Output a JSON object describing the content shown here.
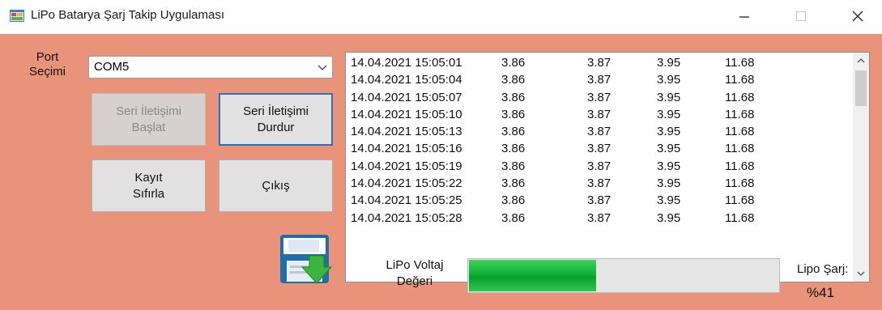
{
  "window": {
    "title": "LiPo Batarya Şarj Takip Uygulaması",
    "icon": "app-form-icon",
    "controls": [
      "minimize-icon",
      "maximize-icon",
      "close-icon"
    ],
    "background_color": "#E8937A"
  },
  "port": {
    "label_line1": "Port",
    "label_line2": "Seçimi",
    "selected": "COM5"
  },
  "buttons": {
    "start_line1": "Seri İletişimi",
    "start_line2": "Başlat",
    "stop_line1": "Seri İletişimi",
    "stop_line2": "Durdur",
    "reset_line1": "Kayıt",
    "reset_line2": "Sıfırla",
    "exit": "Çıkış"
  },
  "log": {
    "rows": [
      [
        "14.04.2021 15:05:01",
        "3.86",
        "3.87",
        "3.95",
        "11.68"
      ],
      [
        "14.04.2021 15:05:04",
        "3.86",
        "3.87",
        "3.95",
        "11.68"
      ],
      [
        "14.04.2021 15:05:07",
        "3.86",
        "3.87",
        "3.95",
        "11.68"
      ],
      [
        "14.04.2021 15:05:10",
        "3.86",
        "3.87",
        "3.95",
        "11.68"
      ],
      [
        "14.04.2021 15:05:13",
        "3.86",
        "3.87",
        "3.95",
        "11.68"
      ],
      [
        "14.04.2021 15:05:16",
        "3.86",
        "3.87",
        "3.95",
        "11.68"
      ],
      [
        "14.04.2021 15:05:19",
        "3.86",
        "3.87",
        "3.95",
        "11.68"
      ],
      [
        "14.04.2021 15:05:22",
        "3.86",
        "3.87",
        "3.95",
        "11.68"
      ],
      [
        "14.04.2021 15:05:25",
        "3.86",
        "3.87",
        "3.95",
        "11.68"
      ],
      [
        "14.04.2021 15:05:28",
        "3.86",
        "3.87",
        "3.95",
        "11.68"
      ]
    ]
  },
  "voltage": {
    "label_line1": "LiPo Voltaj",
    "label_line2": "Değeri",
    "progress": 0.41
  },
  "charge": {
    "label": "Lipo Şarj:",
    "value": "%41"
  }
}
